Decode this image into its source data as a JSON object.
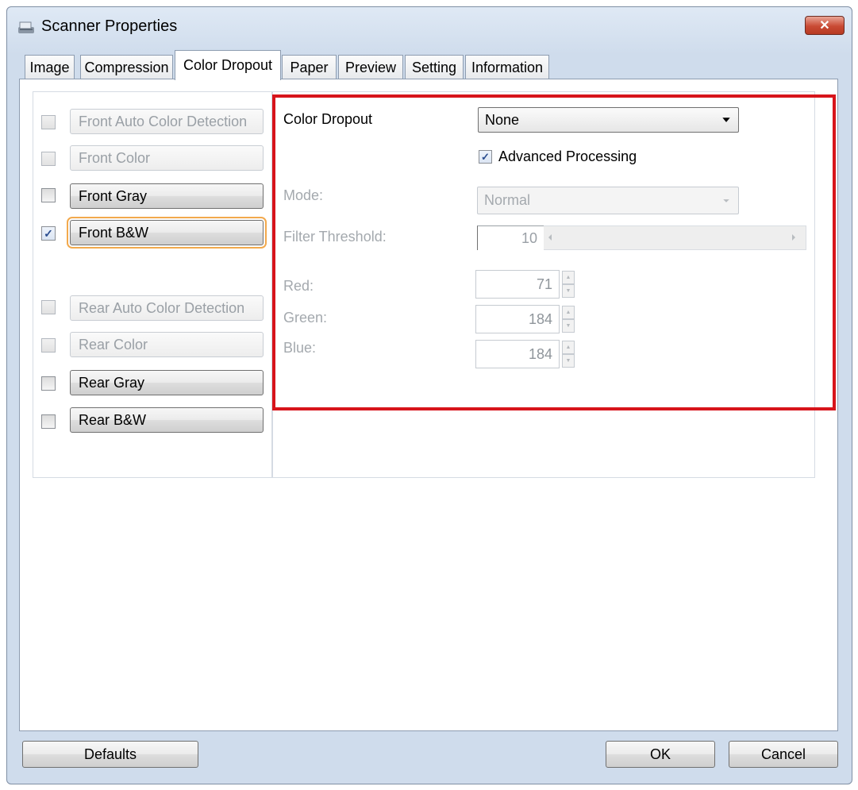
{
  "window": {
    "title": "Scanner Properties",
    "close_glyph": "✕"
  },
  "tabs": [
    {
      "label": "Image"
    },
    {
      "label": "Compression"
    },
    {
      "label": "Color Dropout",
      "active": true
    },
    {
      "label": "Paper"
    },
    {
      "label": "Preview"
    },
    {
      "label": "Setting"
    },
    {
      "label": "Information"
    }
  ],
  "channels": {
    "front_auto": {
      "label": "Front Auto Color Detection",
      "checked": false
    },
    "front_color": {
      "label": "Front Color",
      "checked": false
    },
    "front_gray": {
      "label": "Front Gray",
      "checked": false
    },
    "front_bw": {
      "label": "Front B&W",
      "checked": true
    },
    "rear_auto": {
      "label": "Rear Auto Color Detection",
      "checked": false
    },
    "rear_color": {
      "label": "Rear Color",
      "checked": false
    },
    "rear_gray": {
      "label": "Rear Gray",
      "checked": false
    },
    "rear_bw": {
      "label": "Rear B&W",
      "checked": false
    }
  },
  "check_glyph": "✓",
  "dropout": {
    "label": "Color Dropout",
    "value": "None",
    "advanced_label": "Advanced Processing",
    "advanced_checked": true,
    "mode_label": "Mode:",
    "mode_value": "Normal",
    "filter_label": "Filter Threshold:",
    "filter_value": "10",
    "red_label": "Red:",
    "red_value": "71",
    "green_label": "Green:",
    "green_value": "184",
    "blue_label": "Blue:",
    "blue_value": "184"
  },
  "buttons": {
    "defaults": "Defaults",
    "ok": "OK",
    "cancel": "Cancel"
  },
  "colors": {
    "highlight": "#d7141b",
    "focus": "#f2a94d",
    "close": "#c94a34"
  }
}
